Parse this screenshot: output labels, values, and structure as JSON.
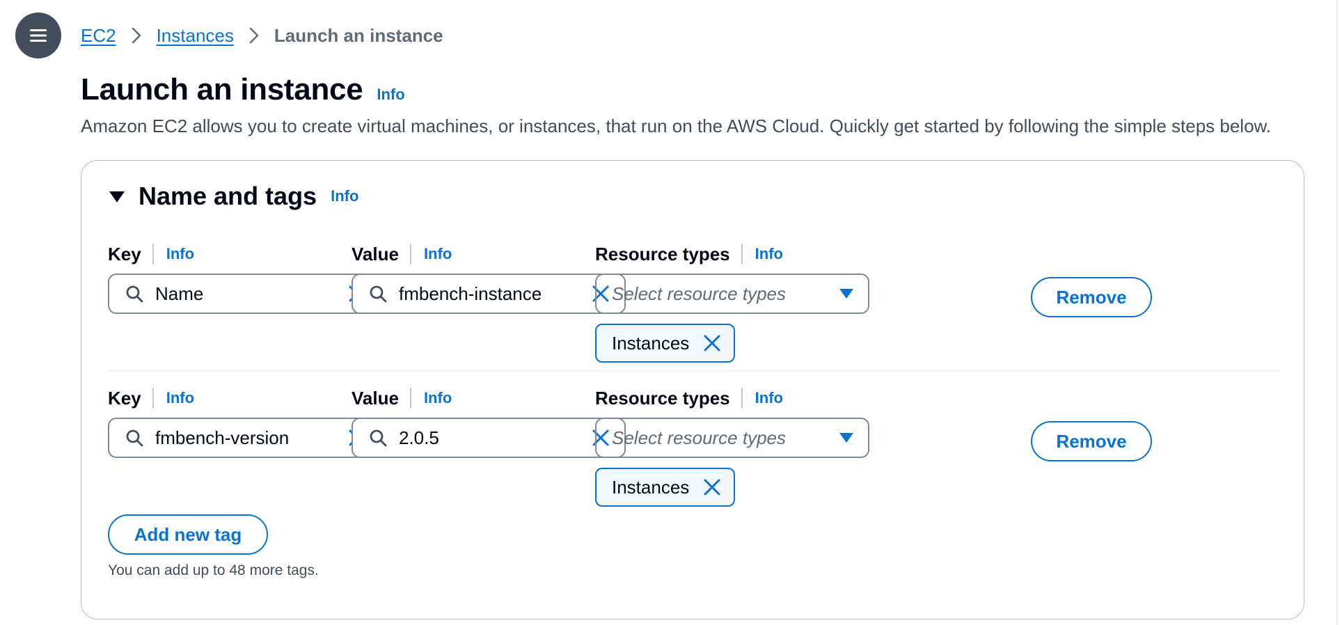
{
  "breadcrumb": {
    "items": [
      "EC2",
      "Instances"
    ],
    "current": "Launch an instance"
  },
  "header": {
    "title": "Launch an instance",
    "info": "Info",
    "description": "Amazon EC2 allows you to create virtual machines, or instances, that run on the AWS Cloud. Quickly get started by following the simple steps below."
  },
  "section": {
    "title": "Name and tags",
    "info": "Info",
    "labels": {
      "key": "Key",
      "value": "Value",
      "resource_types": "Resource types",
      "info": "Info"
    },
    "tags": [
      {
        "key": "Name",
        "value": "fmbench-instance",
        "resource_placeholder": "Select resource types",
        "token": "Instances",
        "remove_label": "Remove"
      },
      {
        "key": "fmbench-version",
        "value": "2.0.5",
        "resource_placeholder": "Select resource types",
        "token": "Instances",
        "remove_label": "Remove"
      }
    ],
    "add_tag_label": "Add new tag",
    "hint": "You can add up to 48 more tags."
  },
  "colors": {
    "accent": "#0972d3",
    "text": "#000716",
    "menu_bg": "#414d5c"
  },
  "icons": [
    "menu-icon",
    "chevron-right-icon",
    "caret-down-icon",
    "search-icon",
    "close-icon",
    "dropdown-arrow-icon"
  ]
}
